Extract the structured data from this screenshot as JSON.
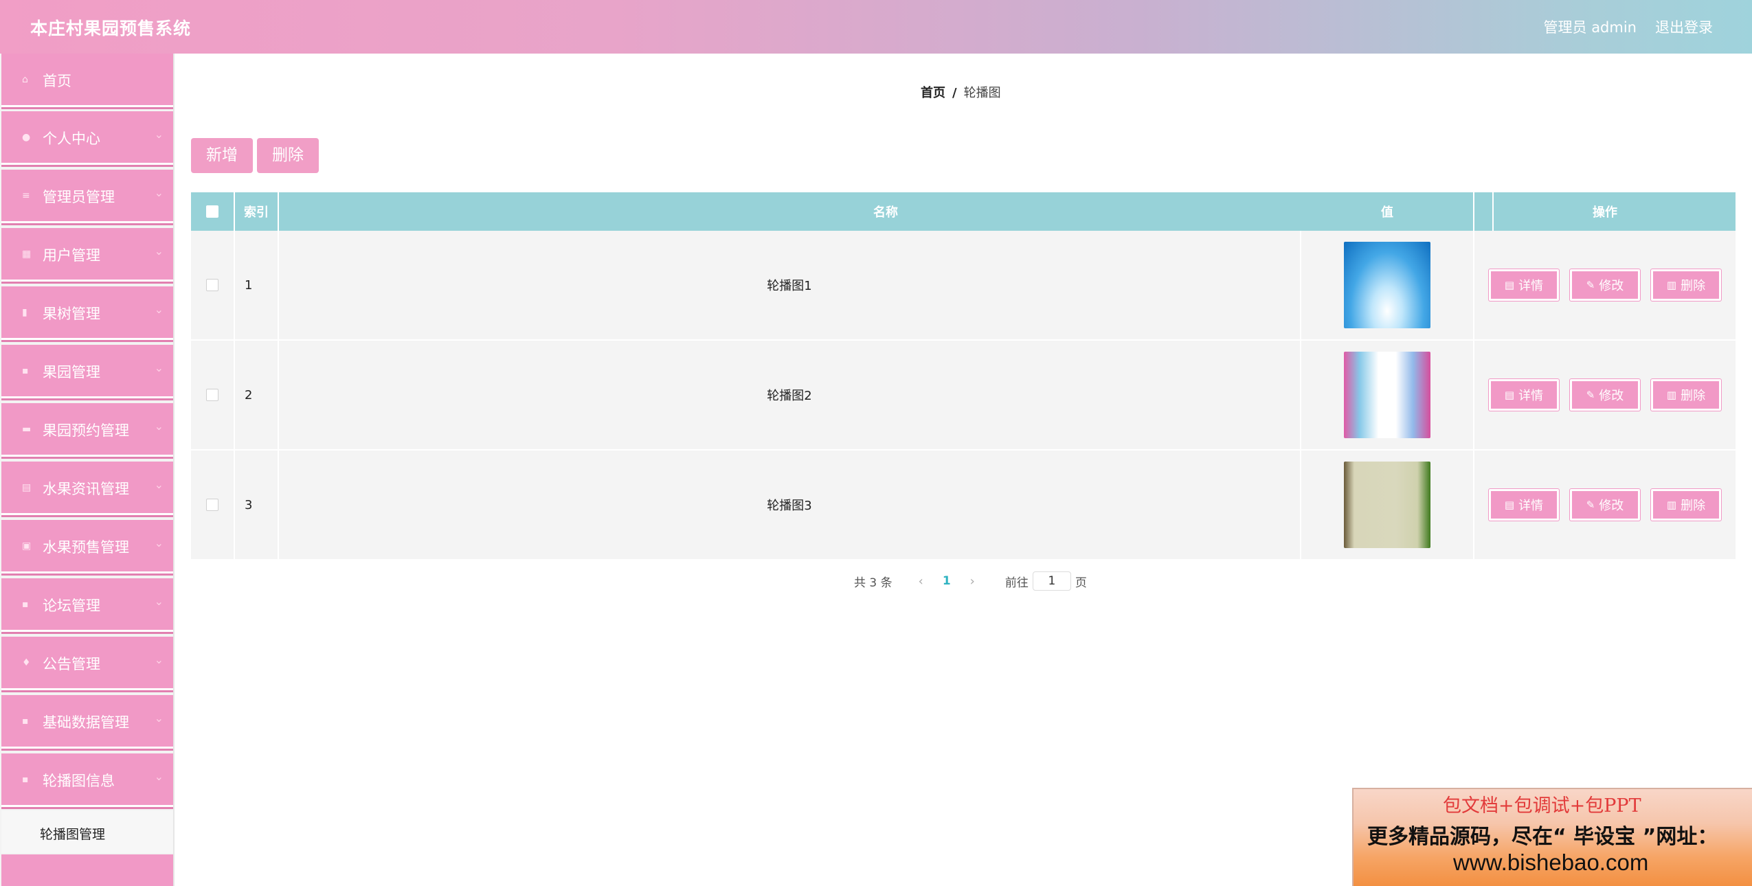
{
  "header": {
    "title": "本庄村果园预售系统",
    "user": "管理员 admin",
    "logout": "退出登录"
  },
  "sidebar": {
    "items": [
      {
        "label": "首页",
        "icon": "home-icon",
        "arrow": ""
      },
      {
        "label": "个人中心",
        "icon": "user-icon",
        "arrow": "⌄"
      },
      {
        "label": "管理员管理",
        "icon": "list-icon",
        "arrow": "⌄"
      },
      {
        "label": "用户管理",
        "icon": "users-icon",
        "arrow": "⌄"
      },
      {
        "label": "果树管理",
        "icon": "bar-chart-icon",
        "arrow": "⌄"
      },
      {
        "label": "果园管理",
        "icon": "grid-icon",
        "arrow": "⌄"
      },
      {
        "label": "果园预约管理",
        "icon": "monitor-icon",
        "arrow": "⌄"
      },
      {
        "label": "水果资讯管理",
        "icon": "table-icon",
        "arrow": "⌄"
      },
      {
        "label": "水果预售管理",
        "icon": "document-icon",
        "arrow": "⌄"
      },
      {
        "label": "论坛管理",
        "icon": "grid-icon",
        "arrow": "⌄"
      },
      {
        "label": "公告管理",
        "icon": "bell-icon",
        "arrow": "⌄"
      },
      {
        "label": "基础数据管理",
        "icon": "grid-icon",
        "arrow": "⌄"
      },
      {
        "label": "轮播图信息",
        "icon": "grid-icon",
        "arrow": "⌄"
      }
    ],
    "submenu": {
      "label": "轮播图管理"
    }
  },
  "breadcrumb": {
    "home": "首页",
    "sep": "/",
    "current": "轮播图"
  },
  "toolbar": {
    "add_label": "新增",
    "delete_label": "删除"
  },
  "table": {
    "headers": {
      "index": "索引",
      "name": "名称",
      "value": "值",
      "actions": "操作"
    },
    "rows": [
      {
        "index": "1",
        "name": "轮播图1"
      },
      {
        "index": "2",
        "name": "轮播图2"
      },
      {
        "index": "3",
        "name": "轮播图3"
      }
    ],
    "actions": {
      "detail": "详情",
      "edit": "修改",
      "delete": "删除"
    }
  },
  "pagination": {
    "total": "共 3 条",
    "prev": "‹",
    "page": "1",
    "next": "›",
    "goto_label": "前往",
    "goto_value": "1",
    "unit": "页"
  },
  "ad": {
    "line1": "包文档+包调试+包PPT",
    "line2": "更多精品源码，尽在“ 毕设宝 ”网址：",
    "line3": "www.bishebao.com"
  },
  "colors": {
    "accent_pink": "#f199c6",
    "table_header": "#97d2d8",
    "pager_active": "#2fb3c1"
  }
}
